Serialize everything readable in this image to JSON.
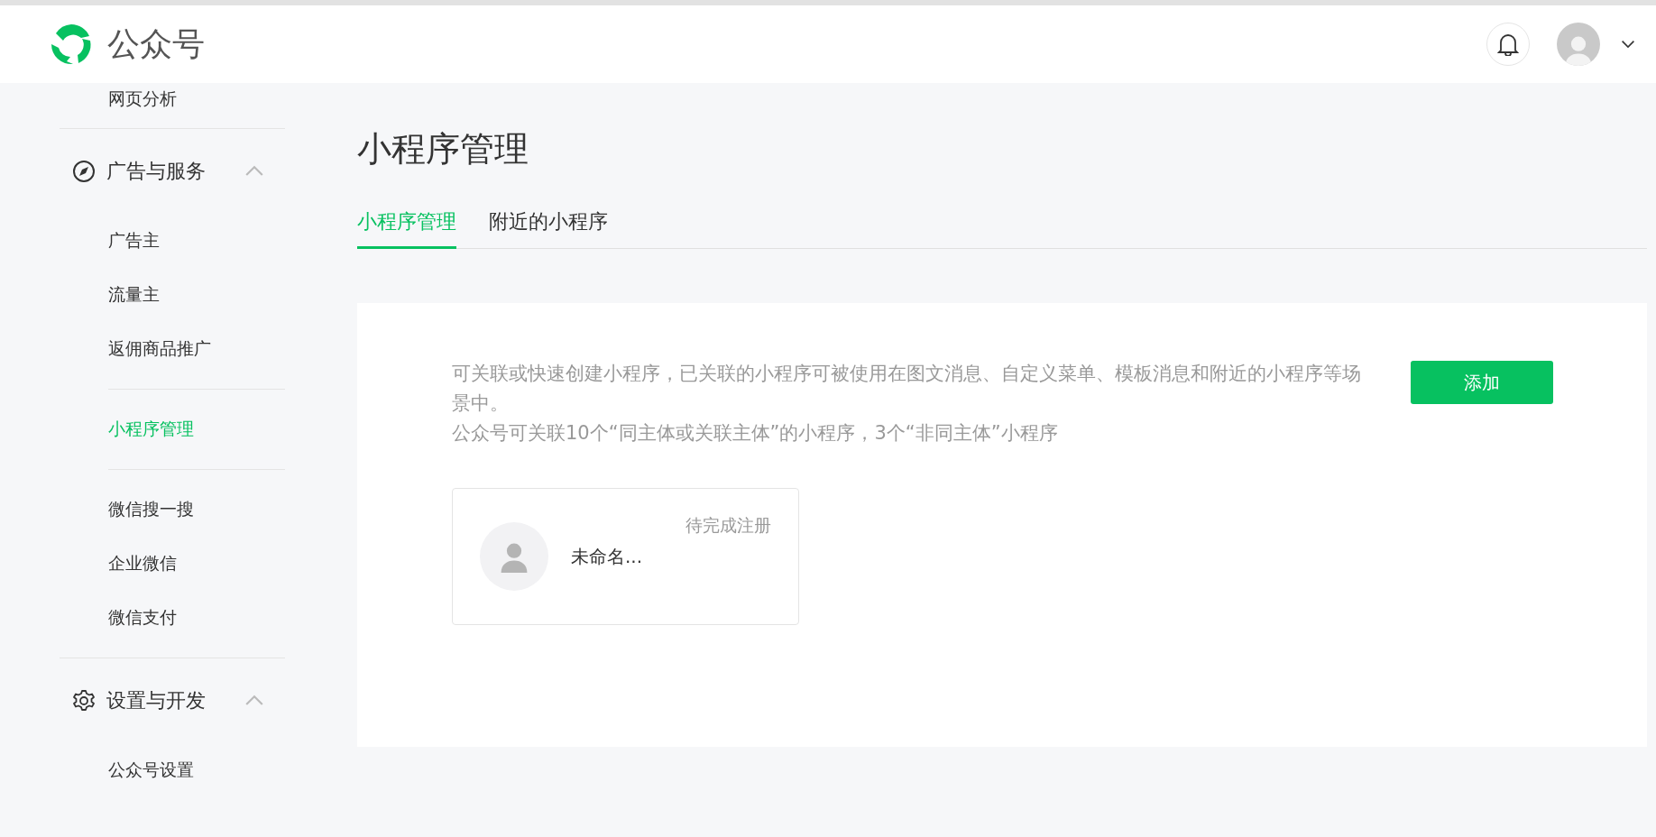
{
  "header": {
    "title": "公众号"
  },
  "sidebar": {
    "items": [
      {
        "kind": "item",
        "label": "网页分析",
        "selected": false
      },
      {
        "kind": "divider"
      },
      {
        "kind": "section",
        "label": "广告与服务",
        "expanded": true
      },
      {
        "kind": "item",
        "label": "广告主",
        "selected": false
      },
      {
        "kind": "item",
        "label": "流量主",
        "selected": false
      },
      {
        "kind": "item",
        "label": "返佣商品推广",
        "selected": false
      },
      {
        "kind": "subdivider"
      },
      {
        "kind": "item",
        "label": "小程序管理",
        "selected": true
      },
      {
        "kind": "subdivider"
      },
      {
        "kind": "item",
        "label": "微信搜一搜",
        "selected": false
      },
      {
        "kind": "item",
        "label": "企业微信",
        "selected": false
      },
      {
        "kind": "item",
        "label": "微信支付",
        "selected": false
      },
      {
        "kind": "divider"
      },
      {
        "kind": "section",
        "label": "设置与开发",
        "expanded": true
      },
      {
        "kind": "item",
        "label": "公众号设置",
        "selected": false
      }
    ]
  },
  "page": {
    "title": "小程序管理",
    "tabs": [
      {
        "label": "小程序管理",
        "selected": true
      },
      {
        "label": "附近的小程序",
        "selected": false
      }
    ],
    "description": [
      "可关联或快速创建小程序，已关联的小程序可被使用在图文消息、自定义菜单、模板消息和附近的小程序等场景中。",
      "公众号可关联10个“同主体或关联主体”的小程序，3个“非同主体”小程序"
    ],
    "add_button": "添加",
    "mini_programs": [
      {
        "name": "未命名...",
        "status": "待完成注册"
      }
    ]
  }
}
